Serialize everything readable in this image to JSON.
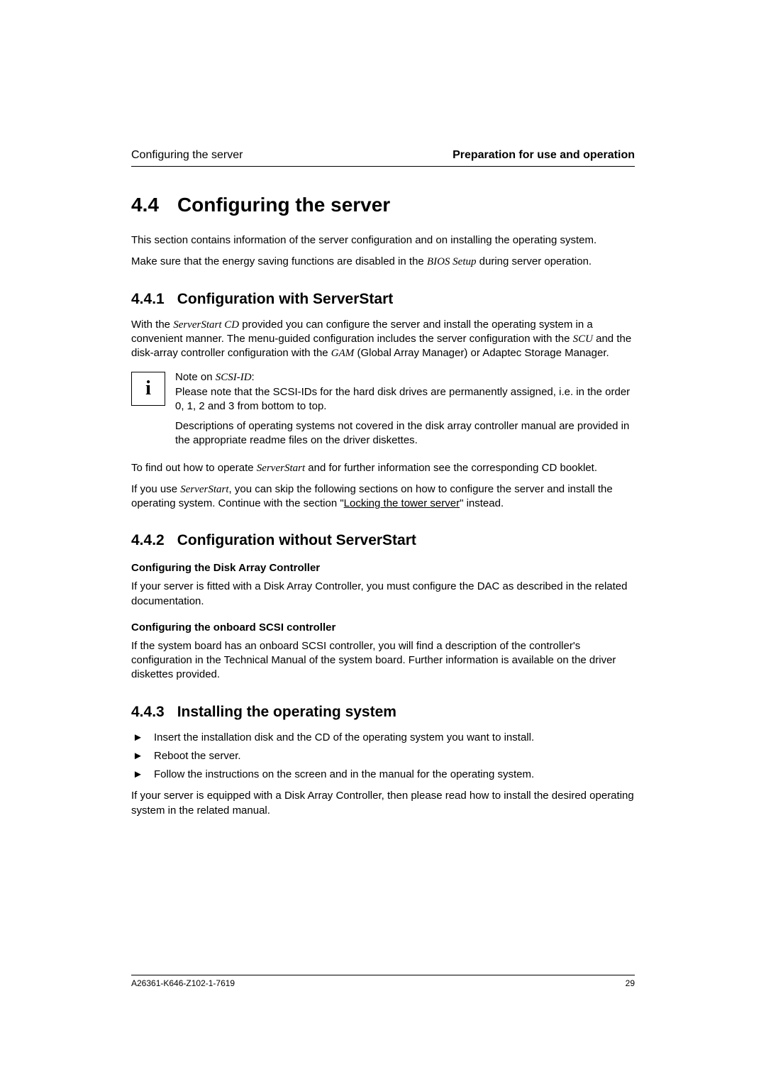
{
  "header": {
    "left": "Configuring the server",
    "right": "Preparation for use and operation"
  },
  "h1": {
    "num": "4.4",
    "title": "Configuring the server"
  },
  "intro1": "This section contains information of the server configuration and on installing the operating system.",
  "intro2a": "Make sure that the energy saving functions are disabled in the ",
  "intro2b": "BIOS Setup",
  "intro2c": " during server operation.",
  "s441": {
    "num": "4.4.1",
    "title": "Configuration with ServerStart",
    "p1a": "With the ",
    "p1b": "ServerStart CD",
    "p1c": " provided you can configure the server and install the operating system in a convenient manner. The menu-guided configuration includes the server configuration with the ",
    "p1d": "SCU",
    "p1e": " and the disk-array controller configuration with the ",
    "p1f": "GAM",
    "p1g": " (Global Array Manager) or Adaptec Storage Manager.",
    "note1a": "Note on ",
    "note1b": "SCSI-ID",
    "note1c": ":",
    "note2": "Please note that the SCSI-IDs for the hard disk drives are permanently assigned, i.e. in the order 0, 1, 2 and 3 from bottom to top.",
    "note3": "Descriptions of operating systems not covered in the disk array controller manual are provided in the appropriate readme files on the driver diskettes.",
    "p2a": "To find out how to operate ",
    "p2b": "ServerStart",
    "p2c": " and for further information see the corresponding CD booklet.",
    "p3a": "If you use ",
    "p3b": "ServerStart",
    "p3c": ", you can skip the following sections on how to configure the server and install the operating system. Continue with the section \"",
    "p3link": "Locking the tower server",
    "p3d": "\" instead."
  },
  "s442": {
    "num": "4.4.2",
    "title": "Configuration without ServerStart",
    "sub1": "Configuring the Disk Array Controller",
    "sub1p": "If your server is fitted with a Disk Array Controller, you must configure the DAC as described in the related documentation.",
    "sub2": "Configuring the onboard SCSI controller",
    "sub2p": "If the system board has an onboard SCSI controller, you will find a description of the controller's configuration in the Technical Manual of the system board. Further information is available on the driver diskettes provided."
  },
  "s443": {
    "num": "4.4.3",
    "title": "Installing the operating system",
    "b1": "Insert the installation disk and the CD of the operating system you want to install.",
    "b2": "Reboot the server.",
    "b3": "Follow the instructions on the screen and in the manual for the operating system.",
    "tail": "If your server is equipped with a Disk Array Controller, then please read how to install the desired operating system in the related manual."
  },
  "footer": {
    "left": "A26361-K646-Z102-1-7619",
    "right": "29"
  },
  "bullet_glyph": "►"
}
